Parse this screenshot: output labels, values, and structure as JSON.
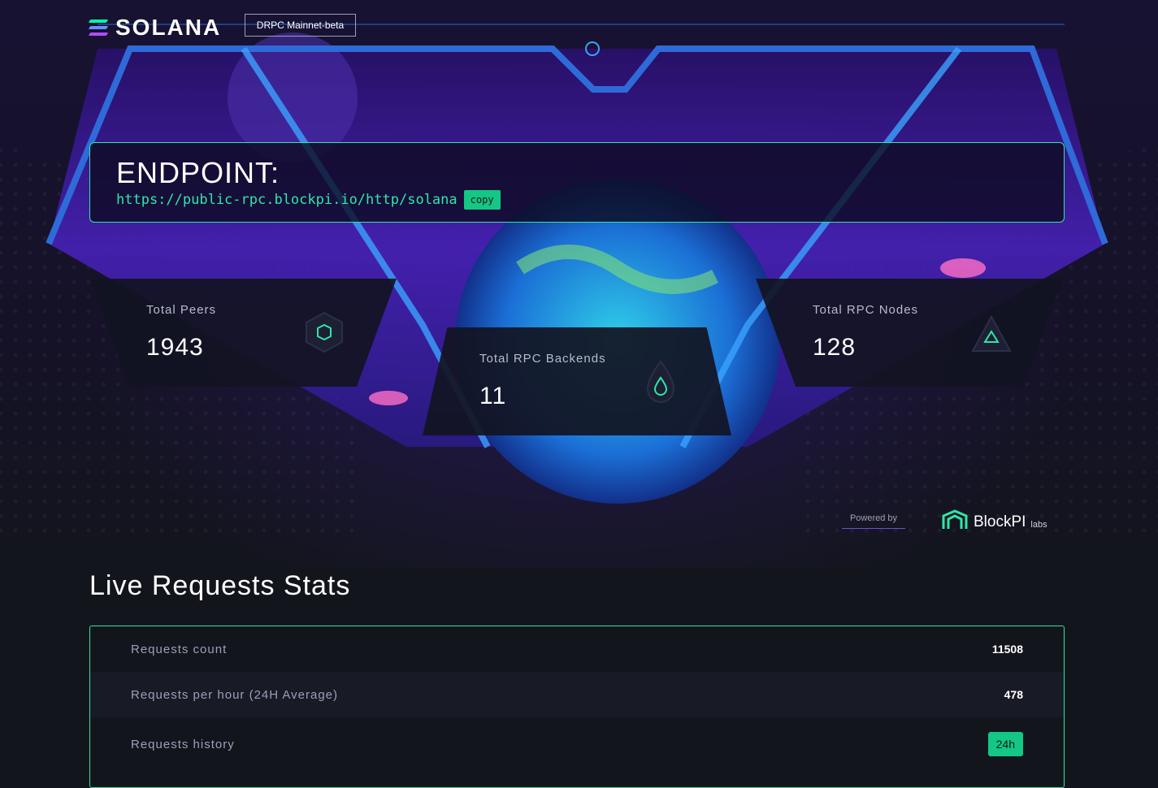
{
  "brand": {
    "name": "SOLANA",
    "network_badge": "DRPC Mainnet-beta"
  },
  "endpoint": {
    "title": "ENDPOINT:",
    "url": "https://public-rpc.blockpi.io/http/solana",
    "copy_label": "copy"
  },
  "stats": {
    "peers": {
      "label": "Total Peers",
      "value": "1943",
      "icon": "hexagon-icon"
    },
    "backends": {
      "label": "Total RPC Backends",
      "value": "11",
      "icon": "drop-icon"
    },
    "nodes": {
      "label": "Total RPC Nodes",
      "value": "128",
      "icon": "triangle-icon"
    }
  },
  "powered": {
    "label": "Powered by",
    "brand": "BlockPI",
    "brand_sub": "labs"
  },
  "live": {
    "title": "Live Requests Stats",
    "rows": [
      {
        "label": "Requests count",
        "value": "11508"
      },
      {
        "label": "Requests per hour (24H Average)",
        "value": "478"
      },
      {
        "label": "Requests history",
        "range": "24h"
      }
    ]
  },
  "colors": {
    "accent": "#2fe6a8",
    "button": "#14c784",
    "frame": "#2f6ad9",
    "background": "#13151d"
  }
}
